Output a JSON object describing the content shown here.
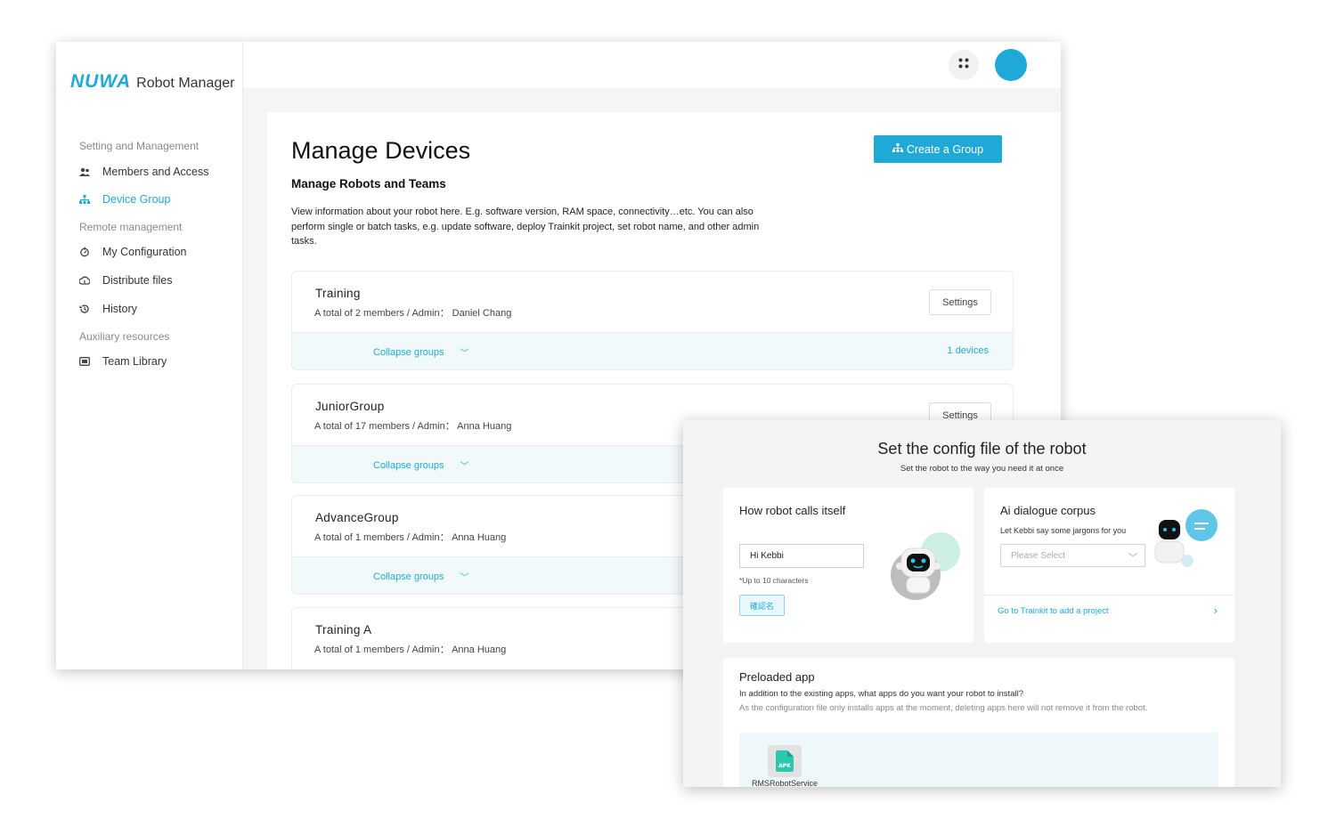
{
  "app": {
    "logo_mark": "NUWA",
    "logo_text": "Robot Manager"
  },
  "sidebar": {
    "sections": [
      {
        "label": "Setting and Management"
      },
      {
        "label": "Remote management"
      },
      {
        "label": "Auxiliary resources"
      }
    ],
    "items": [
      {
        "label": "Members and Access",
        "icon": "members-icon"
      },
      {
        "label": "Device Group",
        "icon": "device-group-icon",
        "active": true
      },
      {
        "label": "My Configuration",
        "icon": "configuration-icon"
      },
      {
        "label": "Distribute files",
        "icon": "distribute-icon"
      },
      {
        "label": "History",
        "icon": "history-icon"
      },
      {
        "label": "Team Library",
        "icon": "library-icon"
      }
    ]
  },
  "header": {
    "apps_icon": "grid-dots-icon",
    "avatar_color": "#1fa9d6"
  },
  "main": {
    "title": "Manage Devices",
    "create_button": "Create a Group",
    "subtitle": "Manage Robots and Teams",
    "description": "View information about your robot here. E.g. software version, RAM space, connectivity…etc. You can also perform single or batch tasks, e.g. update software, deploy Trainkit project, set robot name, and other admin tasks.",
    "groups": [
      {
        "name": "Training",
        "meta": "A total of 2 members / Admin： Daniel Chang",
        "settings": "Settings",
        "collapse": "Collapse groups",
        "devices": "1 devices"
      },
      {
        "name": "JuniorGroup",
        "meta": "A total of 17 members / Admin： Anna Huang",
        "settings": "Settings",
        "collapse": "Collapse groups",
        "devices": ""
      },
      {
        "name": "AdvanceGroup",
        "meta": "A total of 1 members / Admin： Anna Huang",
        "settings": "",
        "collapse": "Collapse groups",
        "devices": ""
      },
      {
        "name": "Training A",
        "meta": "A total of 1 members / Admin： Anna Huang",
        "settings": "",
        "collapse": "",
        "devices": ""
      }
    ]
  },
  "config": {
    "title": "Set the config file of the robot",
    "subtitle": "Set the robot to the way you need it at once",
    "call_name": {
      "title": "How robot calls itself",
      "value": "Hi Kebbi",
      "hint": "*Up to 10 characters",
      "confirm": "確認名"
    },
    "corpus": {
      "title": "Ai dialogue corpus",
      "desc": "Let Kebbi say some jargons for you",
      "placeholder": "Please Select",
      "link": "Go to Trainkit to add a project"
    },
    "preload": {
      "title": "Preloaded app",
      "question": "In addition to the existing apps, what apps do you want your robot to install?",
      "note": "As the configuration file only installs apps at the moment, deleting apps here will not remove it from the robot.",
      "apk_badge": "APK",
      "apk_name": "RMSRobotService"
    }
  },
  "colors": {
    "accent": "#1fa9d6",
    "panel_bg": "#f2f9fb"
  }
}
